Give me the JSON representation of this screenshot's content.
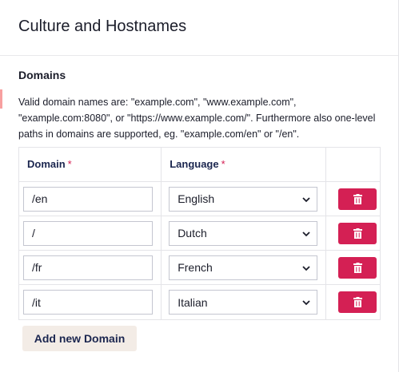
{
  "panel": {
    "title": "Culture and Hostnames"
  },
  "domains": {
    "section_title": "Domains",
    "description": "Valid domain names are: \"example.com\", \"www.example.com\", \"example.com:8080\", or \"https://www.example.com/\". Furthermore also one-level paths in domains are supported, eg. \"example.com/en\" or \"/en\".",
    "columns": {
      "domain": "Domain",
      "language": "Language",
      "required_marker": "*"
    },
    "rows": [
      {
        "domain": "/en",
        "language": "English"
      },
      {
        "domain": "/",
        "language": "Dutch"
      },
      {
        "domain": "/fr",
        "language": "French"
      },
      {
        "domain": "/it",
        "language": "Italian"
      }
    ],
    "add_button_label": "Add new Domain"
  },
  "colors": {
    "danger": "#d42054",
    "text": "#1b264f",
    "add_button_bg": "#f3ece6"
  },
  "icons": {
    "delete": "trash-icon",
    "select": "chevron-down-icon"
  }
}
